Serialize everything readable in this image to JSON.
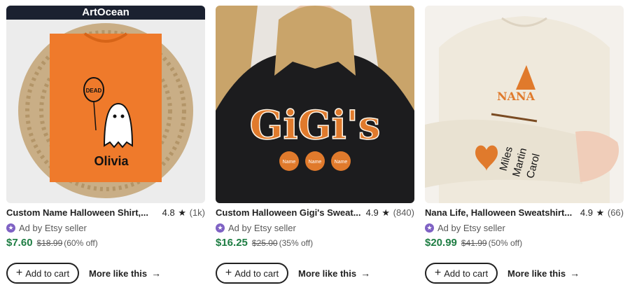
{
  "products": [
    {
      "title": "Custom Name Halloween Shirt,...",
      "rating": "4.8",
      "review_count": "(1k)",
      "ad_label": "Ad by Etsy seller",
      "price": "$7.60",
      "original_price": "$18.99",
      "discount": "(60% off)",
      "add_to_cart": "Add to cart",
      "more_like_this": "More like this",
      "image": {
        "brand": "ArtOcean",
        "balloon_text": "DEAD",
        "name_text": "Olivia"
      }
    },
    {
      "title": "Custom Halloween Gigi's Sweat...",
      "rating": "4.9",
      "review_count": "(840)",
      "ad_label": "Ad by Etsy seller",
      "price": "$16.25",
      "original_price": "$25.00",
      "discount": "(35% off)",
      "add_to_cart": "Add to cart",
      "more_like_this": "More like this",
      "image": {
        "word": "GiGi's",
        "pumpkin_labels": [
          "Name",
          "Name",
          "Name"
        ]
      }
    },
    {
      "title": "Nana Life, Halloween Sweatshirt...",
      "rating": "4.9",
      "review_count": "(66)",
      "ad_label": "Ad by Etsy seller",
      "price": "$20.99",
      "original_price": "$41.99",
      "discount": "(50% off)",
      "add_to_cart": "Add to cart",
      "more_like_this": "More like this",
      "image": {
        "word": "NANA",
        "sleeve_names": [
          "Miles",
          "Martin",
          "Carol"
        ]
      }
    }
  ],
  "colors": {
    "price_green": "#1e7d43",
    "ad_badge_purple": "#7f62c4",
    "shirt_orange": "#ef7a2b",
    "sweatshirt_black": "#1c1c1e",
    "sweatshirt_cream": "#efe9dc"
  }
}
